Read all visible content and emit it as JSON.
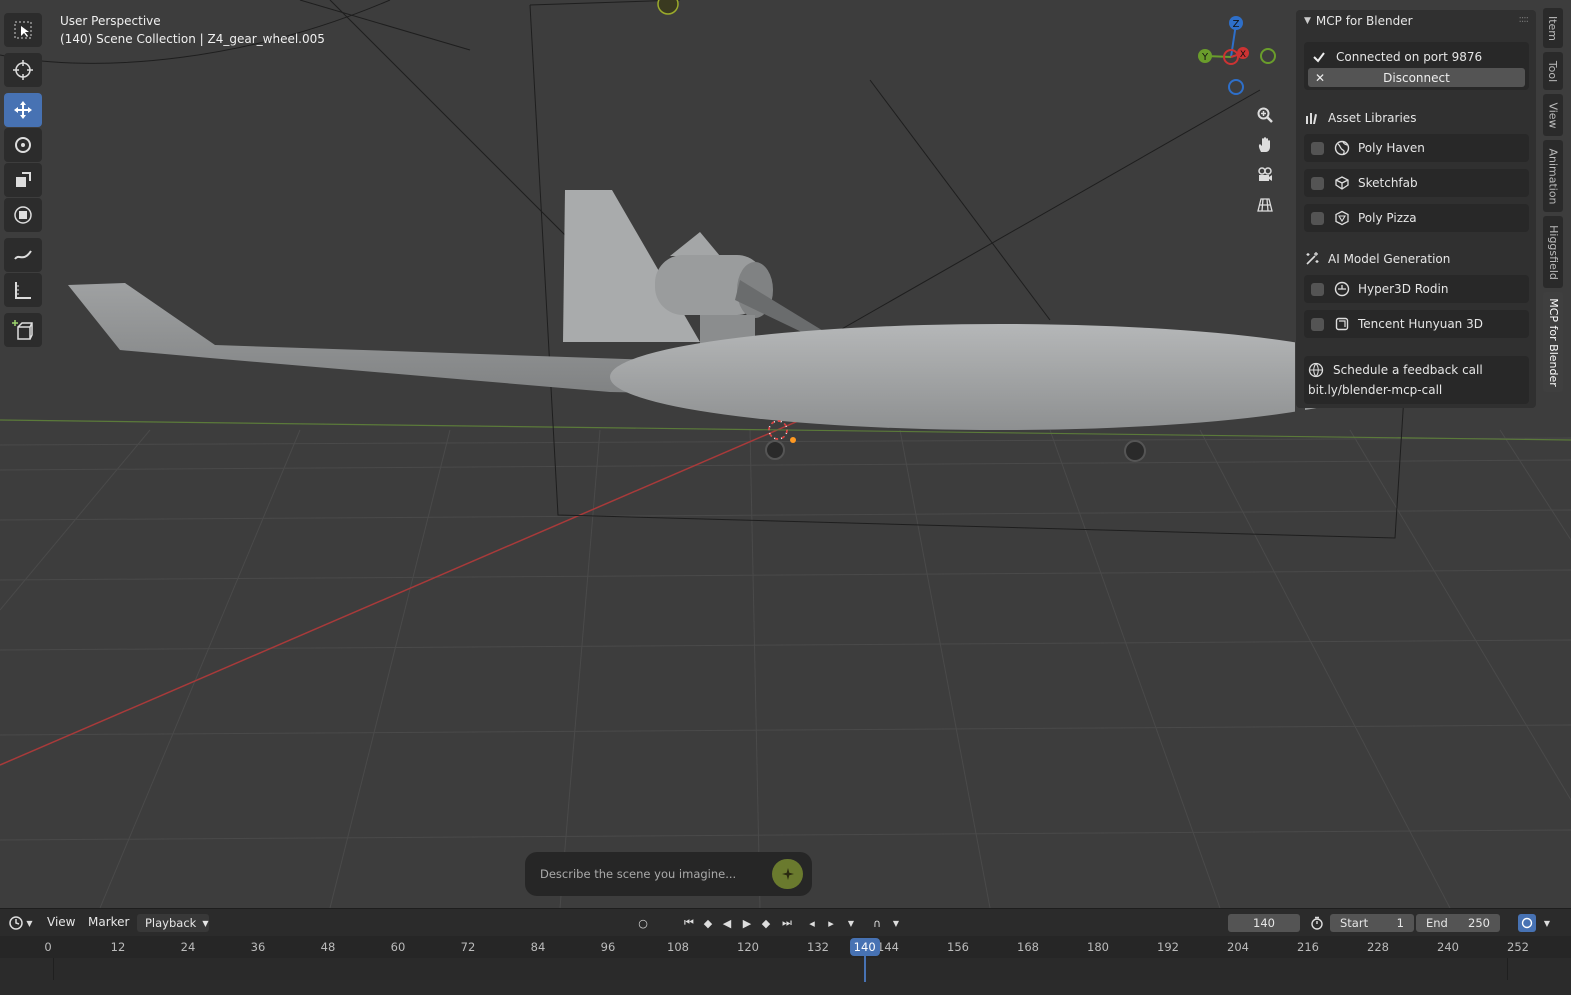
{
  "viewport": {
    "title": "User Perspective",
    "subtitle": "(140) Scene Collection | Z4_gear_wheel.005",
    "gizmo": {
      "x": "X",
      "y": "Y",
      "z": "Z"
    }
  },
  "npanel": {
    "header": "MCP for Blender",
    "status": "Connected on port 9876",
    "disconnect": "Disconnect",
    "asset_libraries": {
      "label": "Asset Libraries",
      "items": [
        "Poly Haven",
        "Sketchfab",
        "Poly Pizza"
      ]
    },
    "ai_generation": {
      "label": "AI Model Generation",
      "items": [
        "Hyper3D Rodin",
        "Tencent Hunyuan 3D"
      ]
    },
    "feedback": {
      "label": "Schedule a feedback call",
      "link": "bit.ly/blender-mcp-call"
    }
  },
  "tabs": [
    "Item",
    "Tool",
    "View",
    "Animation",
    "Higgsfield",
    "MCP for Blender"
  ],
  "prompt": {
    "placeholder": "Describe the scene you imagine..."
  },
  "timeline": {
    "menus": [
      "View",
      "Marker",
      "Playback"
    ],
    "current_frame": "140",
    "start_label": "Start",
    "start": "1",
    "end_label": "End",
    "end": "250",
    "ticks": [
      "0",
      "12",
      "24",
      "36",
      "48",
      "60",
      "72",
      "84",
      "96",
      "108",
      "120",
      "132",
      "144",
      "156",
      "168",
      "180",
      "192",
      "204",
      "216",
      "228",
      "240",
      "252"
    ],
    "playhead": "140"
  },
  "colors": {
    "accent": "#4772b3",
    "x_axis": "#c33",
    "y_axis": "#6a9d2b",
    "z_axis": "#2e6fc9"
  }
}
